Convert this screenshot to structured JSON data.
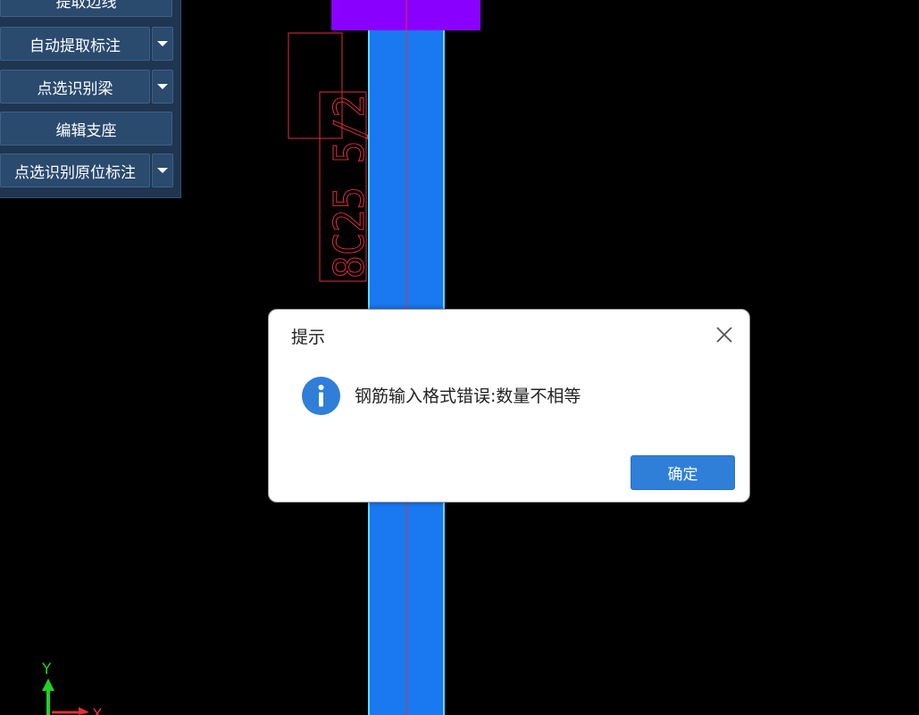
{
  "toolbar": {
    "items": [
      {
        "label": "提取边线",
        "has_dropdown": false
      },
      {
        "label": "自动提取标注",
        "has_dropdown": true
      },
      {
        "label": "点选识别梁",
        "has_dropdown": true
      },
      {
        "label": "编辑支座",
        "has_dropdown": false
      },
      {
        "label": "点选识别原位标注",
        "has_dropdown": true
      }
    ],
    "dropdown_icon": "caret-down-icon"
  },
  "canvas": {
    "annotation_text": "8C25 5/2",
    "colors": {
      "background": "#000000",
      "beam_fill": "#1a78f0",
      "beam_edge": "#5fdcff",
      "centerline": "#e0303a",
      "support_block": "#8a00ff",
      "annotation": "#e0303a"
    },
    "axis": {
      "y_label": "Y",
      "x_label": "X",
      "y_color": "#22d022",
      "x_color": "#e03030"
    }
  },
  "dialog": {
    "title": "提示",
    "message": "钢筋输入格式错误:数量不相等",
    "ok_label": "确定",
    "icon": "info-icon",
    "close_icon": "close-icon",
    "accent_color": "#2f7fd8"
  }
}
